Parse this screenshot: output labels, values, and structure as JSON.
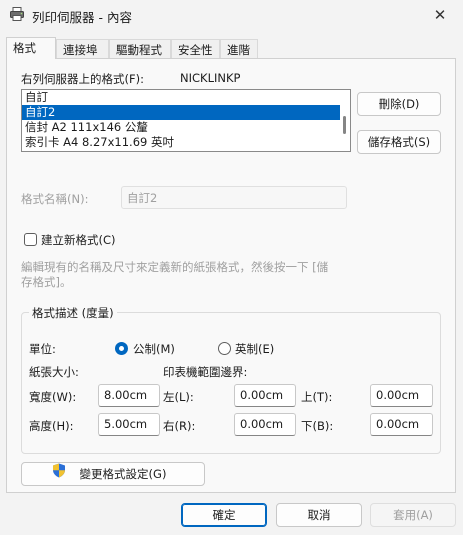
{
  "window": {
    "title": "列印伺服器 - 內容",
    "close_glyph": "✕"
  },
  "tabs": [
    {
      "label": "格式",
      "active": true
    },
    {
      "label": "連接埠",
      "active": false
    },
    {
      "label": "驅動程式",
      "active": false
    },
    {
      "label": "安全性",
      "active": false
    },
    {
      "label": "進階",
      "active": false
    }
  ],
  "forms": {
    "on_server_label": "右列伺服器上的格式(F):",
    "server_name": "NICKLINKP",
    "items": [
      "自訂",
      "自訂2",
      "信封 A2 111x146 公釐",
      "索引卡 A4 8.27x11.69 英吋"
    ],
    "selected_index": 1,
    "delete_label": "刪除(D)",
    "save_label": "儲存格式(S)"
  },
  "form_name": {
    "label": "格式名稱(N):",
    "value": "自訂2"
  },
  "new_form": {
    "label": "建立新格式(C)",
    "checked": false,
    "description_line1": "編輯現有的名稱及尺寸來定義新的紙張格式，然後按一下 [儲",
    "description_line2": "存格式]。"
  },
  "form_description": {
    "title": "格式描述 (度量)",
    "units_label": "單位:",
    "metric_label": "公制(M)",
    "english_label": "英制(E)",
    "metric_selected": true,
    "paper_size_label": "紙張大小:",
    "printer_area_label": "印表機範圍邊界:",
    "width_label": "寬度(W):",
    "width_value": "8.00cm",
    "height_label": "高度(H):",
    "height_value": "5.00cm",
    "left_label": "左(L):",
    "left_value": "0.00cm",
    "right_label": "右(R):",
    "right_value": "0.00cm",
    "top_label": "上(T):",
    "top_value": "0.00cm",
    "bottom_label": "下(B):",
    "bottom_value": "0.00cm"
  },
  "change_settings_label": "變更格式設定(G)",
  "footer": {
    "ok_label": "確定",
    "cancel_label": "取消",
    "apply_label": "套用(A)"
  },
  "colors": {
    "accent": "#0067c0",
    "shield_blue": "#2b6fd6",
    "shield_yellow": "#f2c230"
  }
}
